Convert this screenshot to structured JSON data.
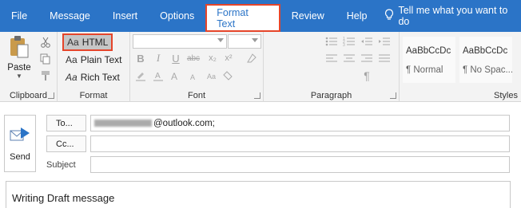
{
  "tabs": [
    {
      "label": "File"
    },
    {
      "label": "Message"
    },
    {
      "label": "Insert"
    },
    {
      "label": "Options"
    },
    {
      "label": "Format Text"
    },
    {
      "label": "Review"
    },
    {
      "label": "Help"
    }
  ],
  "tell_me": "Tell me what you want to do",
  "clipboard": {
    "paste_label": "Paste",
    "group_label": "Clipboard"
  },
  "format": {
    "html_label": "HTML",
    "plain_label": "Plain Text",
    "rich_label": "Rich Text",
    "aa_glyph": "Aa",
    "group_label": "Format"
  },
  "font": {
    "group_label": "Font",
    "bold": "B",
    "italic": "I",
    "underline": "U",
    "strike": "abc",
    "subscript": "x₂",
    "superscript": "x²"
  },
  "paragraph": {
    "group_label": "Paragraph"
  },
  "styles": {
    "group_label": "Styles",
    "items": [
      {
        "sample": "AaBbCcDc",
        "name": "¶ Normal"
      },
      {
        "sample": "AaBbCcDc",
        "name": "¶ No Spac..."
      }
    ]
  },
  "compose": {
    "send_label": "Send",
    "to_label": "To...",
    "cc_label": "Cc...",
    "subject_label": "Subject",
    "to_value": "@outlook.com;",
    "body_text": "Writing Draft message"
  },
  "colors": {
    "ribbon_blue": "#2b74c7",
    "highlight": "#e5452a"
  }
}
